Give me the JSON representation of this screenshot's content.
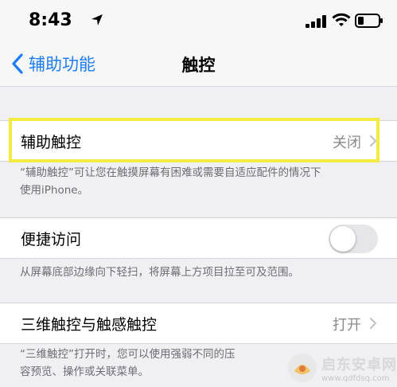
{
  "status_bar": {
    "time": "8:43"
  },
  "nav": {
    "back_label": "辅助功能",
    "title": "触控"
  },
  "assistive_touch": {
    "label": "辅助触控",
    "value": "关闭",
    "footer_line1": "“辅助触控”可让您在触摸屏幕有困难或需要自适应配件的情况下",
    "footer_line2": "使用iPhone。"
  },
  "reachability": {
    "label": "便捷访问",
    "enabled": false,
    "footer": "从屏幕底部边缘向下轻扫，将屏幕上方项目拉至可及范围。"
  },
  "touch_3d": {
    "label": "三维触控与触感触控",
    "value": "打开",
    "footer_line1": "“三维触控”打开时，您可以使用强弱不同的压",
    "footer_line2": "容预览、操作或关联菜单。"
  },
  "watermark": {
    "text": "启东安卓网",
    "url": "www.qdfdsq.com"
  },
  "colors": {
    "accent": "#1e7cf6",
    "highlight": "#f2ec42",
    "background": "#efeff4"
  }
}
